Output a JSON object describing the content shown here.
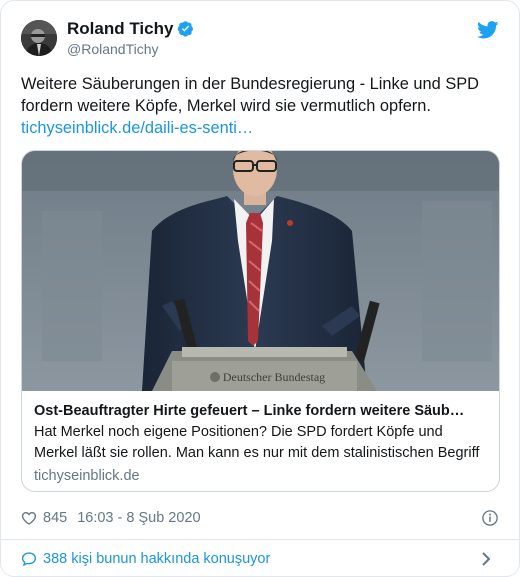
{
  "author": {
    "display_name": "Roland Tichy",
    "handle": "@RolandTichy"
  },
  "tweet": {
    "text": "Weitere Säuberungen in der Bundesregierung - Linke und SPD fordern weitere Köpfe, Merkel wird sie vermutlich opfern.",
    "link_text": "tichyseinblick.de/daili-es-senti…"
  },
  "card": {
    "image_lectern_text": "Deutscher Bundestag",
    "title": "Ost-Beauftragter Hirte gefeuert – Linke fordern weitere Säub…",
    "description": "Hat Merkel noch eigene Positionen? Die SPD fordert Köpfe und Merkel läßt sie rollen. Man kann es nur mit dem stalinistischen Begriff dere",
    "domain": "tichyseinblick.de"
  },
  "meta": {
    "likes": "845",
    "timestamp": "16:03 - 8 Şub 2020"
  },
  "footer": {
    "conversation_text": "388 kişi bunun hakkında konuşuyor"
  },
  "icons": {
    "verified": "verified-badge-icon",
    "brand": "twitter-bird-icon",
    "like": "heart-icon",
    "info": "info-icon",
    "reply": "speech-bubble-icon",
    "more": "chevron-right-icon"
  },
  "colors": {
    "link": "#1b95e0",
    "muted": "#657786",
    "border": "#e1e8ed",
    "text": "#14171a"
  }
}
